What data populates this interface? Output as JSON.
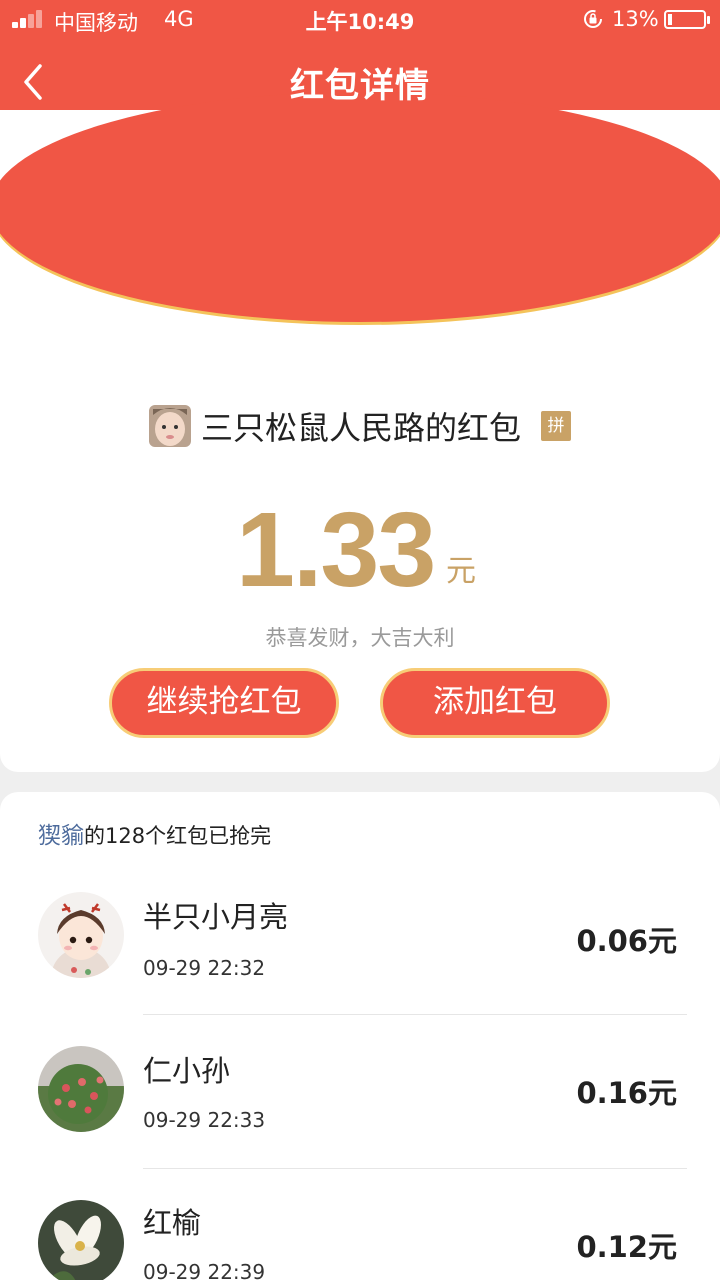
{
  "status": {
    "carrier": "中国移动",
    "network": "4G",
    "time": "上午10:49",
    "battery": "13%",
    "battery_level": 0.13
  },
  "nav": {
    "title": "红包详情"
  },
  "envelope": {
    "sender_name": "三只松鼠人民路的红包",
    "tag": "拼",
    "amount": "1.33",
    "unit": "元",
    "blessing": "恭喜发财，大吉大利"
  },
  "buttons": {
    "continue": "继续抢红包",
    "add": "添加红包"
  },
  "summary": {
    "nick": "猰貐",
    "text": "的128个红包已抢完"
  },
  "records": [
    {
      "name": "半只小月亮",
      "time": "09-29 22:32",
      "amount": "0.06元"
    },
    {
      "name": "仁小孙",
      "time": "09-29 22:33",
      "amount": "0.16元"
    },
    {
      "name": "红榆",
      "time": "09-29 22:39",
      "amount": "0.12元"
    }
  ],
  "colors": {
    "brand_red": "#f05645",
    "gold": "#c9a266",
    "button_border": "#f7cd77",
    "nick_blue": "#4d6b9c"
  }
}
